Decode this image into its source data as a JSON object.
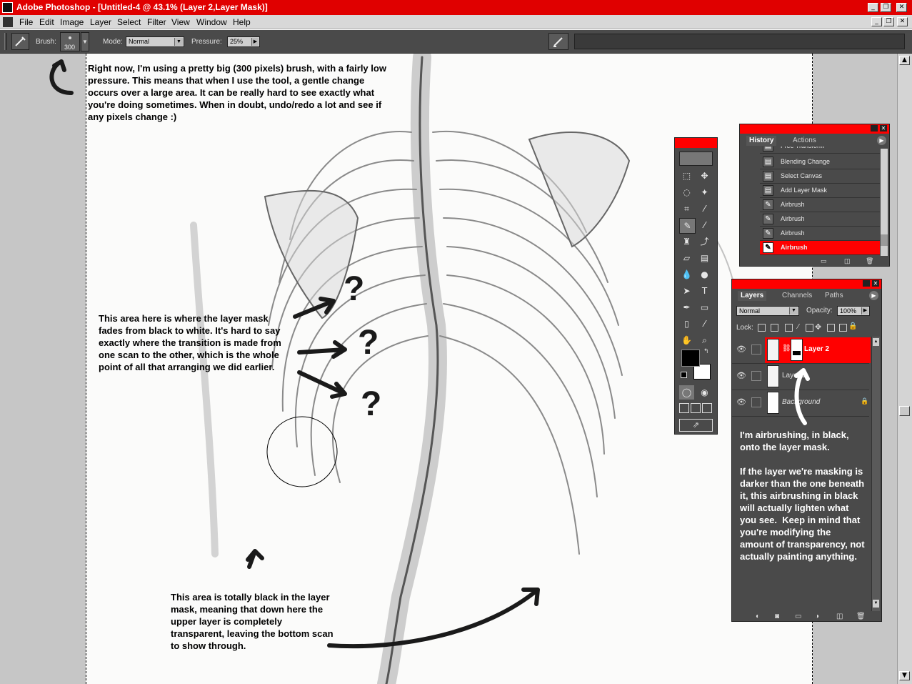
{
  "window": {
    "title": "Adobe Photoshop - [Untitled-4 @ 43.1% (Layer 2,Layer Mask)]",
    "controls": [
      "_",
      "❐",
      "✕"
    ],
    "doc_controls": [
      "_",
      "❐",
      "✕"
    ]
  },
  "menu": [
    "File",
    "Edit",
    "Image",
    "Layer",
    "Select",
    "Filter",
    "View",
    "Window",
    "Help"
  ],
  "options": {
    "brush_label": "Brush:",
    "brush_size": "300",
    "mode_label": "Mode:",
    "mode_value": "Normal",
    "pressure_label": "Pressure:",
    "pressure_value": "25%"
  },
  "annotations": {
    "top": "Right now, I'm using a pretty big (300 pixels) brush, with a fairly low pressure.  This means that when I use the tool, a gentle change occurs over a large area.  It can be really hard to see exactly what you're doing sometimes.  When in doubt, undo/redo a lot and see if any pixels change :)",
    "middle": "This area here is where the layer mask fades from black to white.  It's hard to say exactly where the transition is made from one scan to the other, which is the whole point of all that arranging we did earlier.",
    "bottom": "This area is totally black in the layer mask, meaning that down here the upper layer is completely transparent, leaving the bottom scan to show through.",
    "right": "I'm airbrushing, in black, onto the layer mask.\n\nIf the layer we're masking is darker than the one beneath it, this airbrushing in black will actually lighten what you see.  Keep in mind that you're modifying the amount of transparency, not actually painting anything.",
    "question": "?"
  },
  "history": {
    "tabs": [
      "History",
      "Actions"
    ],
    "items": [
      "Free Transform",
      "Blending Change",
      "Select Canvas",
      "Add Layer Mask",
      "Airbrush",
      "Airbrush",
      "Airbrush",
      "Airbrush"
    ],
    "selected_index": 7
  },
  "layers": {
    "tabs": [
      "Layers",
      "Channels",
      "Paths"
    ],
    "blend_mode": "Normal",
    "opacity_label": "Opacity:",
    "opacity_value": "100%",
    "lock_label": "Lock:",
    "items": [
      {
        "name": "Layer 2",
        "selected": true
      },
      {
        "name": "Layer 1",
        "selected": false
      },
      {
        "name": "Background",
        "selected": false
      }
    ]
  },
  "colors": {
    "titlebar": "#e00000",
    "palette_bg": "#4a4a4a",
    "selection": "#ff0000"
  }
}
